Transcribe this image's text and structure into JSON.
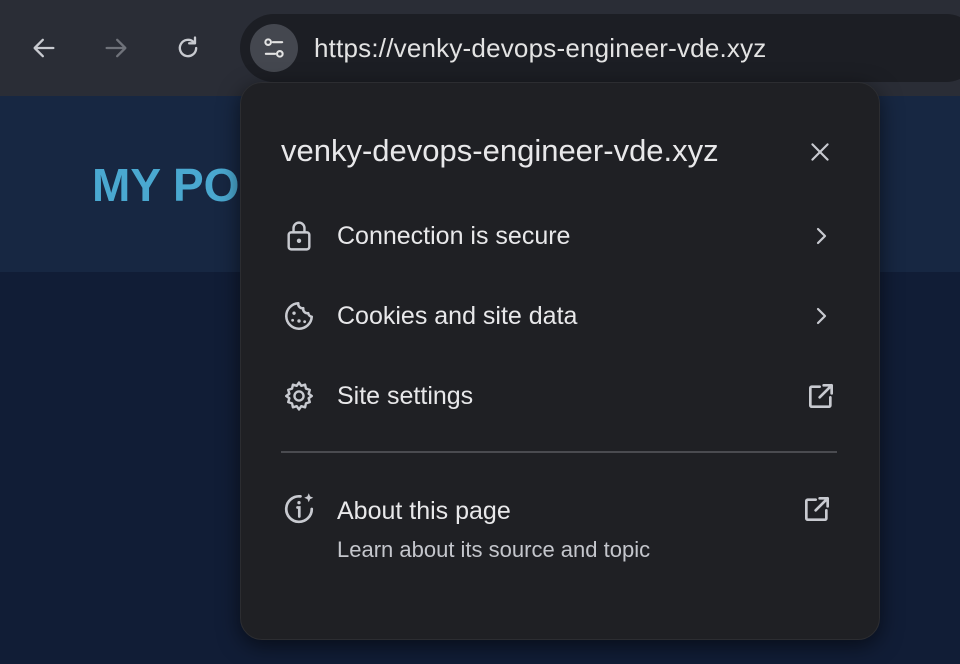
{
  "browser": {
    "url": "https://venky-devops-engineer-vde.xyz",
    "back_icon": "arrow-left-icon",
    "forward_icon": "arrow-right-icon",
    "reload_icon": "reload-icon",
    "site_info_icon": "tune-icon"
  },
  "page": {
    "header_title": "MY PO"
  },
  "site_info_popup": {
    "domain": "venky-devops-engineer-vde.xyz",
    "items": [
      {
        "label": "Connection is secure",
        "icon": "lock-icon",
        "trailing": "chevron-right-icon"
      },
      {
        "label": "Cookies and site data",
        "icon": "cookie-icon",
        "trailing": "chevron-right-icon"
      },
      {
        "label": "Site settings",
        "icon": "gear-icon",
        "trailing": "open-in-new-icon"
      }
    ],
    "about": {
      "label": "About this page",
      "sublabel": "Learn about its source and topic",
      "icon": "info-sparkle-icon",
      "trailing": "open-in-new-icon"
    }
  },
  "colors": {
    "toolbar": "#2a2d36",
    "omnibox": "#1c1e24",
    "popup": "#1f2024",
    "page_title": "#4aa8d0",
    "page_bg": "#111d36"
  }
}
